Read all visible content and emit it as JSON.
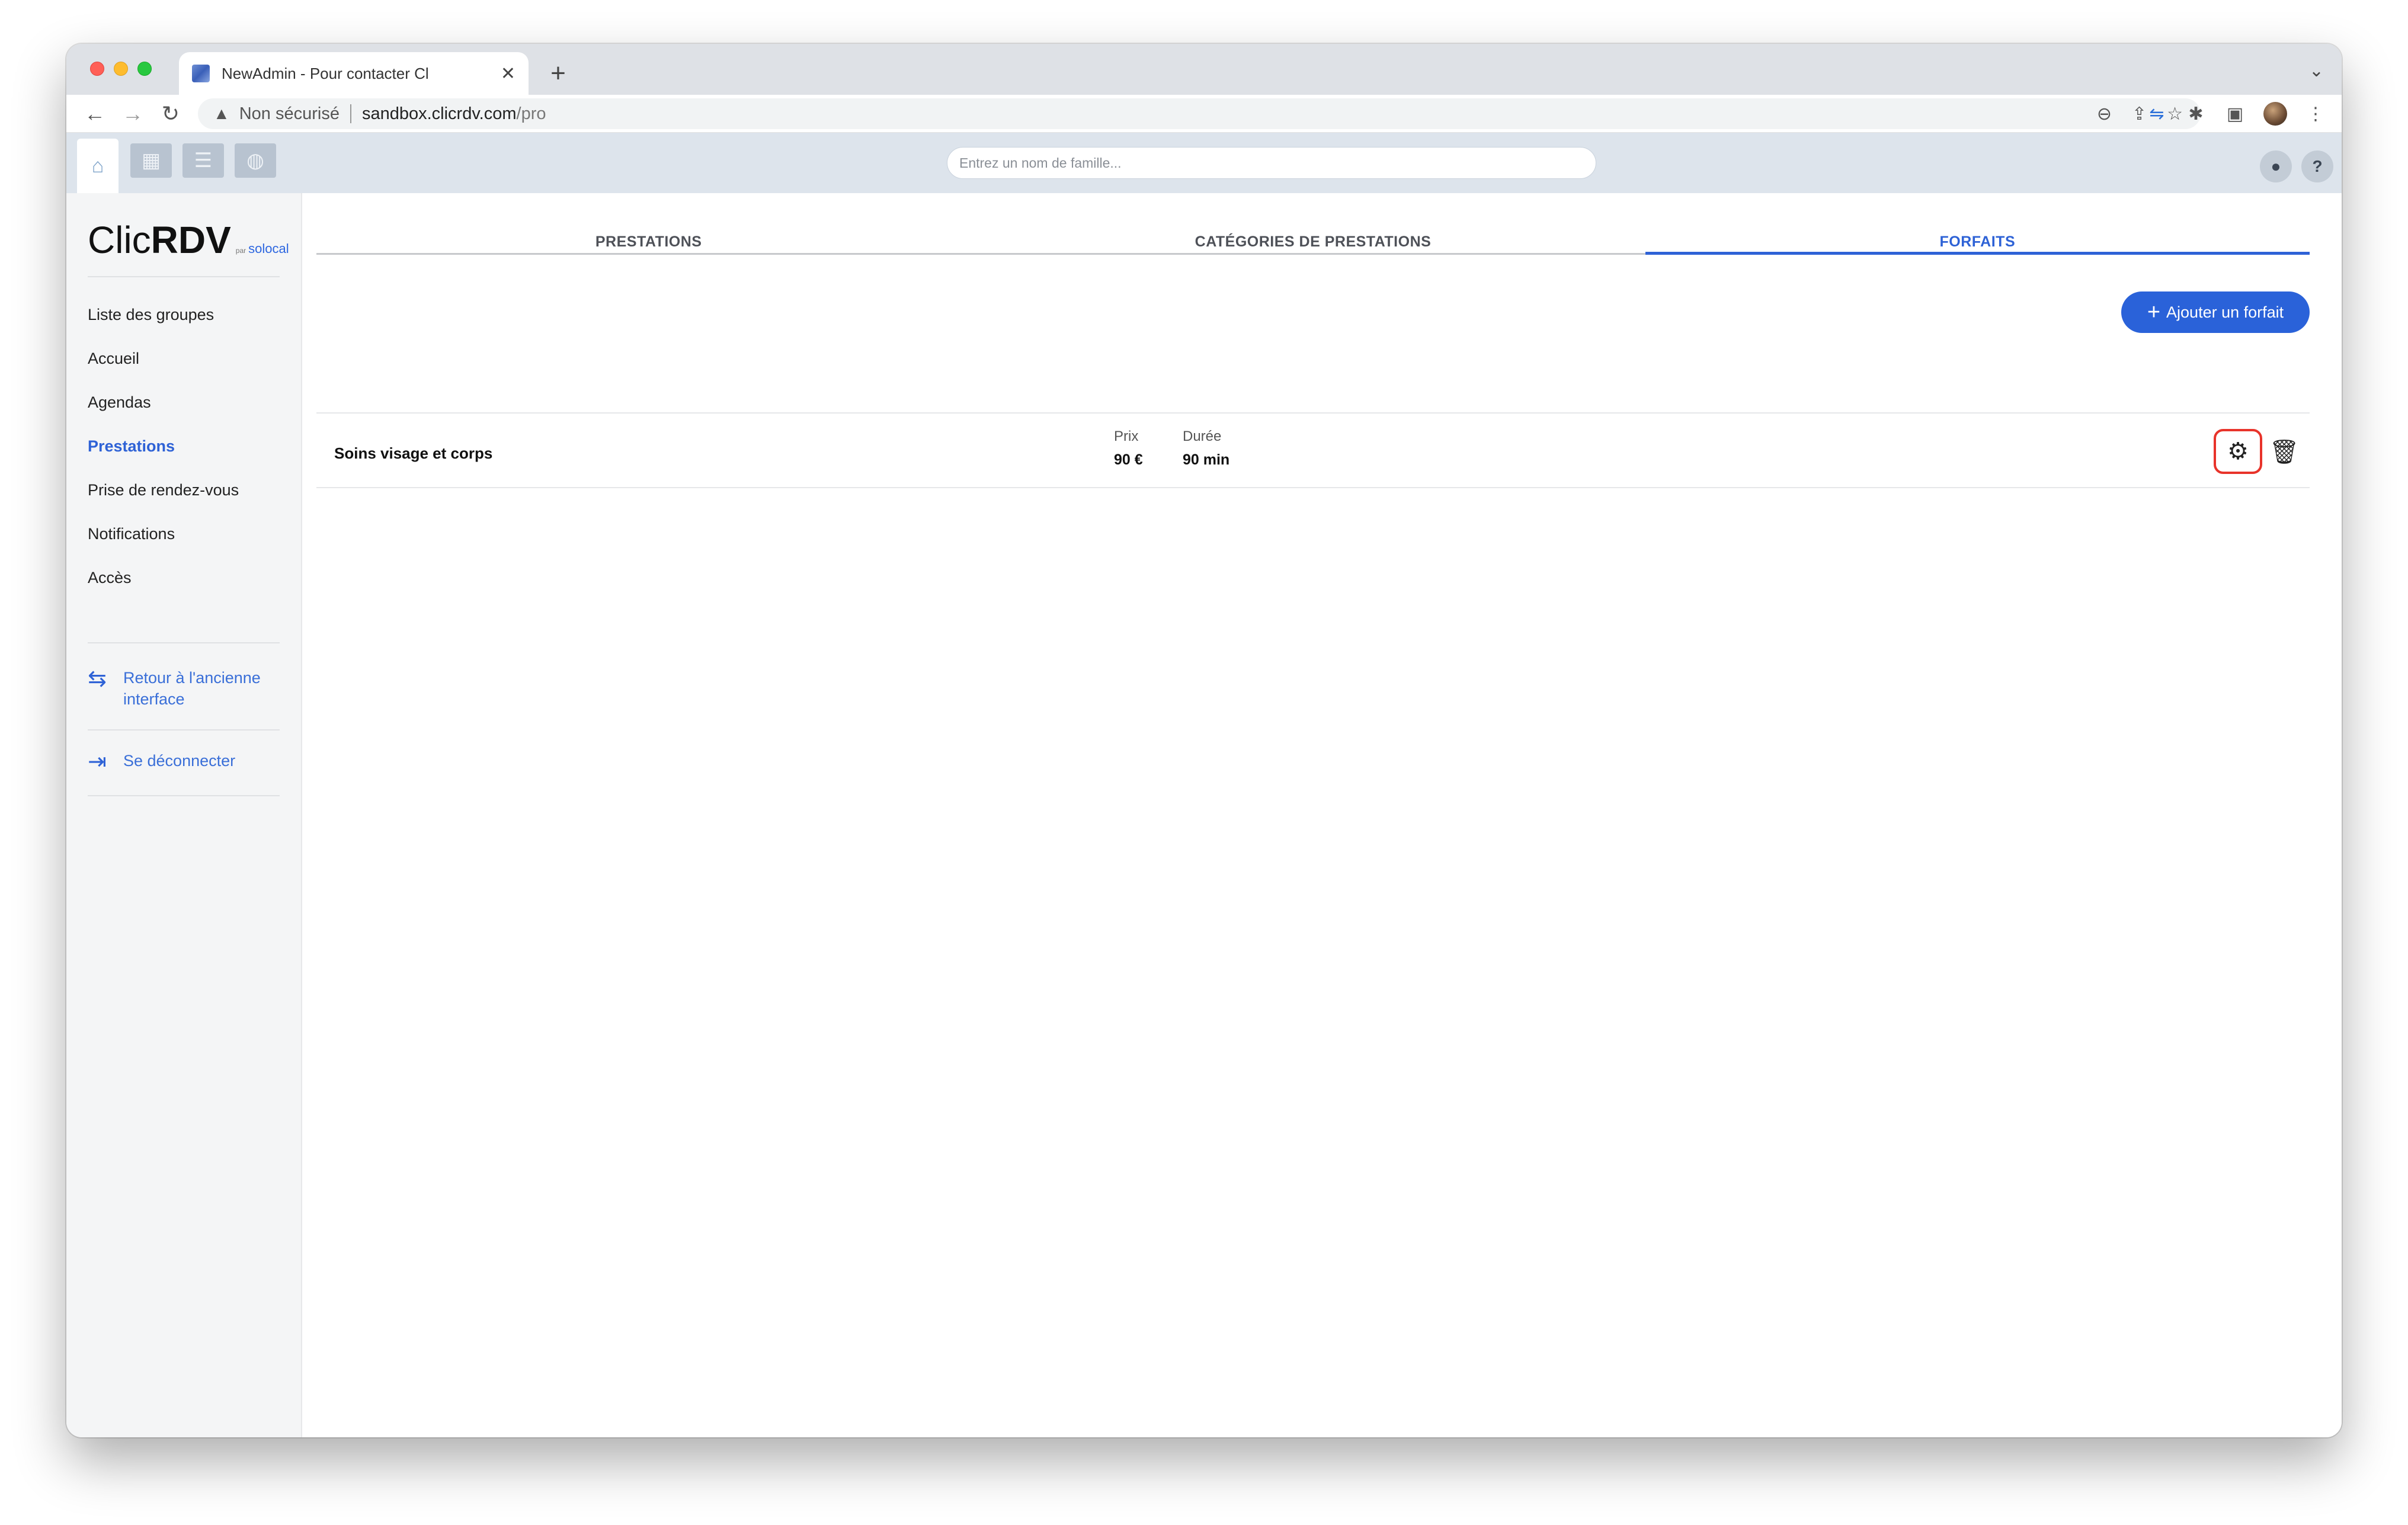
{
  "browser": {
    "tab_title": "NewAdmin - Pour contacter Cl",
    "security_label": "Non sécurisé",
    "url_host": "sandbox.clicrdv.com",
    "url_path": "/pro"
  },
  "appbar": {
    "search_placeholder": "Entrez un nom de famille...",
    "help_label": "?"
  },
  "logo": {
    "part1": "Clic",
    "part2": "RDV",
    "by": "par",
    "brand": "solocal"
  },
  "sidebar": {
    "items": [
      {
        "label": "Liste des groupes"
      },
      {
        "label": "Accueil"
      },
      {
        "label": "Agendas"
      },
      {
        "label": "Prestations",
        "active": true
      },
      {
        "label": "Prise de rendez-vous"
      },
      {
        "label": "Notifications"
      },
      {
        "label": "Accès"
      }
    ],
    "old_interface": "Retour à l'ancienne interface",
    "logout": "Se déconnecter"
  },
  "main": {
    "tabs": [
      {
        "label": "PRESTATIONS"
      },
      {
        "label": "CATÉGORIES DE PRESTATIONS"
      },
      {
        "label": "FORFAITS",
        "active": true
      }
    ],
    "add_button": "Ajouter un forfait",
    "rows": [
      {
        "name": "Soins visage et corps",
        "price_label": "Prix",
        "price": "90 €",
        "duration_label": "Durée",
        "duration": "90 min"
      }
    ]
  },
  "colors": {
    "accent": "#2a62d9",
    "highlight": "#e8332a"
  }
}
